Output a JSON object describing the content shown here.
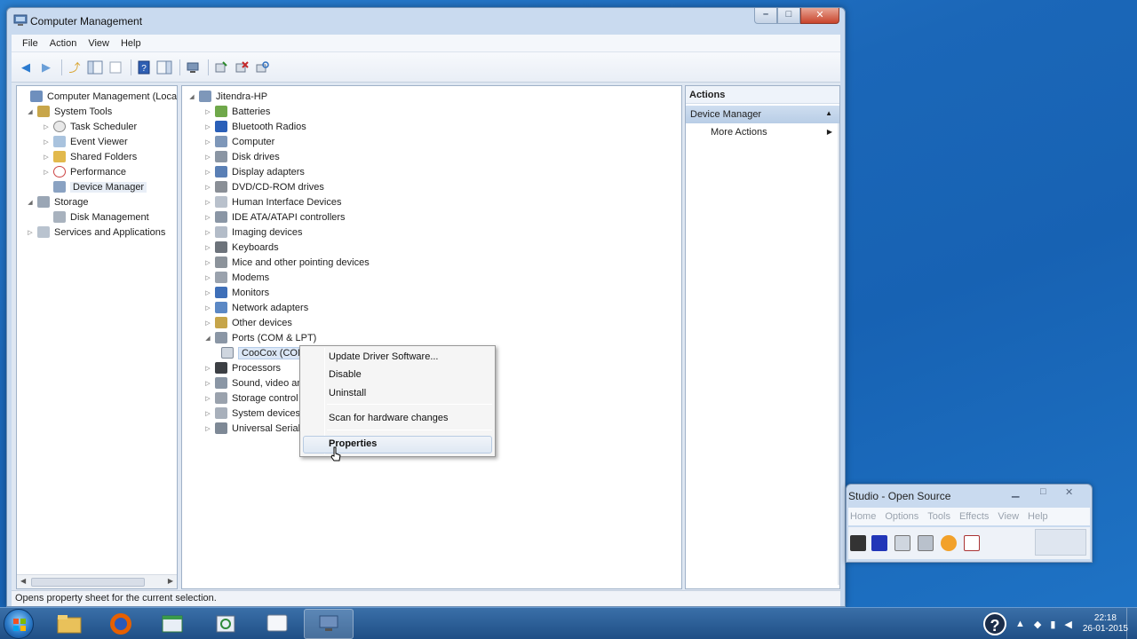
{
  "window": {
    "title": "Computer Management",
    "menu": [
      "File",
      "Action",
      "View",
      "Help"
    ]
  },
  "left_tree": {
    "root": "Computer Management (Local",
    "system_tools": "System Tools",
    "task_scheduler": "Task Scheduler",
    "event_viewer": "Event Viewer",
    "shared_folders": "Shared Folders",
    "performance": "Performance",
    "device_manager": "Device Manager",
    "storage": "Storage",
    "disk_management": "Disk Management",
    "services": "Services and Applications"
  },
  "device_tree": {
    "root": "Jitendra-HP",
    "categories": [
      "Batteries",
      "Bluetooth Radios",
      "Computer",
      "Disk drives",
      "Display adapters",
      "DVD/CD-ROM drives",
      "Human Interface Devices",
      "IDE ATA/ATAPI controllers",
      "Imaging devices",
      "Keyboards",
      "Mice and other pointing devices",
      "Modems",
      "Monitors",
      "Network adapters",
      "Other devices",
      "Ports (COM & LPT)"
    ],
    "port_child": "CooCox (COM4)",
    "after": [
      "Processors",
      "Sound, video an",
      "Storage control",
      "System devices",
      "Universal Serial"
    ]
  },
  "actions": {
    "header": "Actions",
    "group": "Device Manager",
    "more": "More Actions"
  },
  "status": "Opens property sheet for the current selection.",
  "context_menu": {
    "update": "Update Driver Software...",
    "disable": "Disable",
    "uninstall": "Uninstall",
    "scan": "Scan for hardware changes",
    "properties": "Properties"
  },
  "second_window": {
    "title": "Studio - Open Source",
    "menu": [
      "Home",
      "Options",
      "Tools",
      "Effects",
      "View",
      "Help"
    ]
  },
  "taskbar": {
    "time": "22:18",
    "date": "26-01-2015"
  },
  "colors": {
    "desktop": "#1b67b8",
    "window_frame": "#c9daef",
    "selection": "#dbe7f6"
  }
}
